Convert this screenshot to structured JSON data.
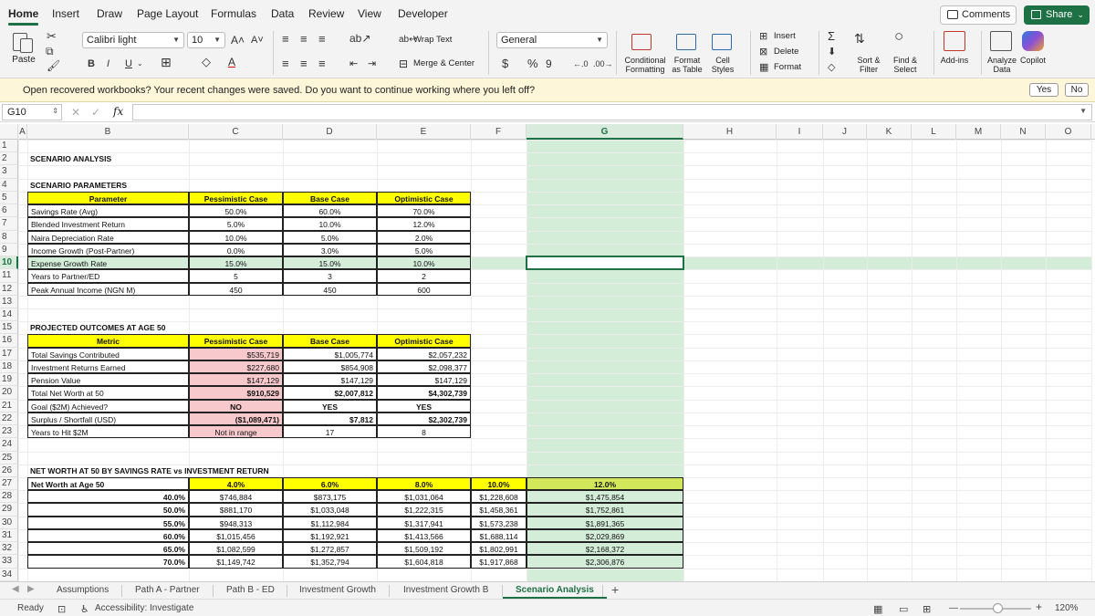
{
  "tabs": [
    "Home",
    "Insert",
    "Draw",
    "Page Layout",
    "Formulas",
    "Data",
    "Review",
    "View",
    "Developer"
  ],
  "actions": {
    "comments": "Comments",
    "share": "Share"
  },
  "ribbon": {
    "paste": "Paste",
    "font_name": "Calibri light",
    "font_size": "10",
    "bold": "B",
    "italic": "I",
    "underline": "U",
    "wrap_text": "Wrap Text",
    "merge_center": "Merge & Center",
    "number_format": "General",
    "currency": "$",
    "percent": "%",
    "comma": "9",
    "conditional_formatting": "Conditional Formatting",
    "format_as_table": "Format as Table",
    "cell_styles": "Cell Styles",
    "insert": "Insert",
    "delete": "Delete",
    "format": "Format",
    "sort_filter": "Sort & Filter",
    "find_select": "Find & Select",
    "add_ins": "Add-ins",
    "analyze_data": "Analyze Data",
    "copilot": "Copilot"
  },
  "infobar": {
    "message": "Open recovered workbooks?  Your recent changes were saved. Do you want to continue working where you left off?",
    "yes": "Yes",
    "no": "No"
  },
  "formula_bar": {
    "name_box": "G10",
    "fx": "fx",
    "value": ""
  },
  "columns": [
    "A",
    "B",
    "C",
    "D",
    "E",
    "F",
    "G",
    "H",
    "I",
    "J",
    "K",
    "L",
    "M",
    "N",
    "O"
  ],
  "selected_cell": "G10",
  "title": "SCENARIO ANALYSIS",
  "parameters": {
    "section": "SCENARIO PARAMETERS",
    "headers": [
      "Parameter",
      "Pessimistic Case",
      "Base Case",
      "Optimistic Case"
    ],
    "rows": [
      [
        "Savings Rate (Avg)",
        "50.0%",
        "60.0%",
        "70.0%"
      ],
      [
        "Blended Investment Return",
        "5.0%",
        "10.0%",
        "12.0%"
      ],
      [
        "Naira Depreciation Rate",
        "10.0%",
        "5.0%",
        "2.0%"
      ],
      [
        "Income Growth (Post-Partner)",
        "0.0%",
        "3.0%",
        "5.0%"
      ],
      [
        "Expense Growth Rate",
        "15.0%",
        "15.0%",
        "10.0%"
      ],
      [
        "Years to Partner/ED",
        "5",
        "3",
        "2"
      ],
      [
        "Peak Annual Income (NGN M)",
        "450",
        "450",
        "600"
      ]
    ]
  },
  "outcomes": {
    "section": "PROJECTED OUTCOMES AT AGE 50",
    "headers": [
      "Metric",
      "Pessimistic Case",
      "Base Case",
      "Optimistic Case"
    ],
    "rows": [
      [
        "Total Savings Contributed",
        "$535,719",
        "$1,005,774",
        "$2,057,232"
      ],
      [
        "Investment Returns Earned",
        "$227,680",
        "$854,908",
        "$2,098,377"
      ],
      [
        "Pension Value",
        "$147,129",
        "$147,129",
        "$147,129"
      ],
      [
        "Total Net Worth at 50",
        "$910,529",
        "$2,007,812",
        "$4,302,739"
      ],
      [
        "Goal ($2M) Achieved?",
        "NO",
        "YES",
        "YES"
      ],
      [
        "Surplus / Shortfall (USD)",
        "($1,089,471)",
        "$7,812",
        "$2,302,739"
      ],
      [
        "Years to Hit $2M",
        "Not in range",
        "17",
        "8"
      ]
    ]
  },
  "sensitivity": {
    "section": "NET WORTH AT 50 BY SAVINGS RATE vs INVESTMENT RETURN",
    "corner": "Net Worth at Age 50",
    "returns": [
      "4.0%",
      "6.0%",
      "8.0%",
      "10.0%",
      "12.0%"
    ],
    "rows": [
      {
        "rate": "40.0%",
        "values": [
          "$746,884",
          "$873,175",
          "$1,031,064",
          "$1,228,608",
          "$1,475,854"
        ]
      },
      {
        "rate": "50.0%",
        "values": [
          "$881,170",
          "$1,033,048",
          "$1,222,315",
          "$1,458,361",
          "$1,752,861"
        ]
      },
      {
        "rate": "55.0%",
        "values": [
          "$948,313",
          "$1,112,984",
          "$1,317,941",
          "$1,573,238",
          "$1,891,365"
        ]
      },
      {
        "rate": "60.0%",
        "values": [
          "$1,015,456",
          "$1,192,921",
          "$1,413,566",
          "$1,688,114",
          "$2,029,869"
        ]
      },
      {
        "rate": "65.0%",
        "values": [
          "$1,082,599",
          "$1,272,857",
          "$1,509,192",
          "$1,802,991",
          "$2,168,372"
        ]
      },
      {
        "rate": "70.0%",
        "values": [
          "$1,149,742",
          "$1,352,794",
          "$1,604,818",
          "$1,917,868",
          "$2,306,876"
        ]
      }
    ]
  },
  "sheets": [
    "Assumptions",
    "Path A - Partner",
    "Path B - ED",
    "Investment Growth",
    "Investment Growth B",
    "Scenario Analysis"
  ],
  "active_sheet": "Scenario Analysis",
  "status": {
    "ready": "Ready",
    "accessibility": "Accessibility: Investigate",
    "zoom": "120%"
  },
  "colors": {
    "accent": "#1e7145",
    "header_yellow": "#ffff00",
    "shortfall_pink": "#f8c9cc",
    "selection_green": "#d4edd9",
    "return_header_lime": "#d2e85a"
  }
}
